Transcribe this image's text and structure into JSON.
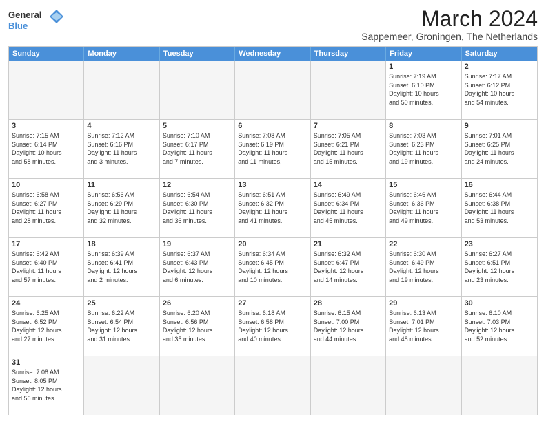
{
  "header": {
    "logo_general": "General",
    "logo_blue": "Blue",
    "title": "March 2024",
    "subtitle": "Sappemeer, Groningen, The Netherlands"
  },
  "weekdays": [
    "Sunday",
    "Monday",
    "Tuesday",
    "Wednesday",
    "Thursday",
    "Friday",
    "Saturday"
  ],
  "rows": [
    [
      {
        "day": "",
        "empty": true
      },
      {
        "day": "",
        "empty": true
      },
      {
        "day": "",
        "empty": true
      },
      {
        "day": "",
        "empty": true
      },
      {
        "day": "",
        "empty": true
      },
      {
        "day": "1",
        "info": "Sunrise: 7:19 AM\nSunset: 6:10 PM\nDaylight: 10 hours\nand 50 minutes."
      },
      {
        "day": "2",
        "info": "Sunrise: 7:17 AM\nSunset: 6:12 PM\nDaylight: 10 hours\nand 54 minutes."
      }
    ],
    [
      {
        "day": "3",
        "info": "Sunrise: 7:15 AM\nSunset: 6:14 PM\nDaylight: 10 hours\nand 58 minutes."
      },
      {
        "day": "4",
        "info": "Sunrise: 7:12 AM\nSunset: 6:16 PM\nDaylight: 11 hours\nand 3 minutes."
      },
      {
        "day": "5",
        "info": "Sunrise: 7:10 AM\nSunset: 6:17 PM\nDaylight: 11 hours\nand 7 minutes."
      },
      {
        "day": "6",
        "info": "Sunrise: 7:08 AM\nSunset: 6:19 PM\nDaylight: 11 hours\nand 11 minutes."
      },
      {
        "day": "7",
        "info": "Sunrise: 7:05 AM\nSunset: 6:21 PM\nDaylight: 11 hours\nand 15 minutes."
      },
      {
        "day": "8",
        "info": "Sunrise: 7:03 AM\nSunset: 6:23 PM\nDaylight: 11 hours\nand 19 minutes."
      },
      {
        "day": "9",
        "info": "Sunrise: 7:01 AM\nSunset: 6:25 PM\nDaylight: 11 hours\nand 24 minutes."
      }
    ],
    [
      {
        "day": "10",
        "info": "Sunrise: 6:58 AM\nSunset: 6:27 PM\nDaylight: 11 hours\nand 28 minutes."
      },
      {
        "day": "11",
        "info": "Sunrise: 6:56 AM\nSunset: 6:29 PM\nDaylight: 11 hours\nand 32 minutes."
      },
      {
        "day": "12",
        "info": "Sunrise: 6:54 AM\nSunset: 6:30 PM\nDaylight: 11 hours\nand 36 minutes."
      },
      {
        "day": "13",
        "info": "Sunrise: 6:51 AM\nSunset: 6:32 PM\nDaylight: 11 hours\nand 41 minutes."
      },
      {
        "day": "14",
        "info": "Sunrise: 6:49 AM\nSunset: 6:34 PM\nDaylight: 11 hours\nand 45 minutes."
      },
      {
        "day": "15",
        "info": "Sunrise: 6:46 AM\nSunset: 6:36 PM\nDaylight: 11 hours\nand 49 minutes."
      },
      {
        "day": "16",
        "info": "Sunrise: 6:44 AM\nSunset: 6:38 PM\nDaylight: 11 hours\nand 53 minutes."
      }
    ],
    [
      {
        "day": "17",
        "info": "Sunrise: 6:42 AM\nSunset: 6:40 PM\nDaylight: 11 hours\nand 57 minutes."
      },
      {
        "day": "18",
        "info": "Sunrise: 6:39 AM\nSunset: 6:41 PM\nDaylight: 12 hours\nand 2 minutes."
      },
      {
        "day": "19",
        "info": "Sunrise: 6:37 AM\nSunset: 6:43 PM\nDaylight: 12 hours\nand 6 minutes."
      },
      {
        "day": "20",
        "info": "Sunrise: 6:34 AM\nSunset: 6:45 PM\nDaylight: 12 hours\nand 10 minutes."
      },
      {
        "day": "21",
        "info": "Sunrise: 6:32 AM\nSunset: 6:47 PM\nDaylight: 12 hours\nand 14 minutes."
      },
      {
        "day": "22",
        "info": "Sunrise: 6:30 AM\nSunset: 6:49 PM\nDaylight: 12 hours\nand 19 minutes."
      },
      {
        "day": "23",
        "info": "Sunrise: 6:27 AM\nSunset: 6:51 PM\nDaylight: 12 hours\nand 23 minutes."
      }
    ],
    [
      {
        "day": "24",
        "info": "Sunrise: 6:25 AM\nSunset: 6:52 PM\nDaylight: 12 hours\nand 27 minutes."
      },
      {
        "day": "25",
        "info": "Sunrise: 6:22 AM\nSunset: 6:54 PM\nDaylight: 12 hours\nand 31 minutes."
      },
      {
        "day": "26",
        "info": "Sunrise: 6:20 AM\nSunset: 6:56 PM\nDaylight: 12 hours\nand 35 minutes."
      },
      {
        "day": "27",
        "info": "Sunrise: 6:18 AM\nSunset: 6:58 PM\nDaylight: 12 hours\nand 40 minutes."
      },
      {
        "day": "28",
        "info": "Sunrise: 6:15 AM\nSunset: 7:00 PM\nDaylight: 12 hours\nand 44 minutes."
      },
      {
        "day": "29",
        "info": "Sunrise: 6:13 AM\nSunset: 7:01 PM\nDaylight: 12 hours\nand 48 minutes."
      },
      {
        "day": "30",
        "info": "Sunrise: 6:10 AM\nSunset: 7:03 PM\nDaylight: 12 hours\nand 52 minutes."
      }
    ],
    [
      {
        "day": "31",
        "info": "Sunrise: 7:08 AM\nSunset: 8:05 PM\nDaylight: 12 hours\nand 56 minutes."
      },
      {
        "day": "",
        "empty": true
      },
      {
        "day": "",
        "empty": true
      },
      {
        "day": "",
        "empty": true
      },
      {
        "day": "",
        "empty": true
      },
      {
        "day": "",
        "empty": true
      },
      {
        "day": "",
        "empty": true
      }
    ]
  ]
}
